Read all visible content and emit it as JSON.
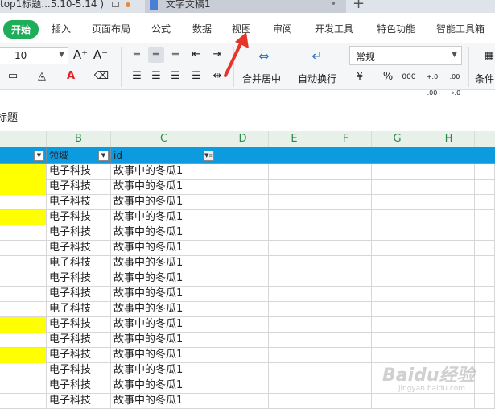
{
  "tabs": {
    "doc1_title": "top1标题...5.10-5.14 )",
    "doc2_title": "文字文稿1",
    "new_tab": "+"
  },
  "menu": {
    "home": "开始",
    "insert": "插入",
    "page_layout": "页面布局",
    "formula": "公式",
    "data": "数据",
    "view": "视图",
    "review": "审阅",
    "developer": "开发工具",
    "special": "特色功能",
    "smart_toolbox": "智能工具箱"
  },
  "ribbon": {
    "font_size": "10",
    "grow_font": "A⁺",
    "shrink_font": "A⁻",
    "merge_center": "合并居中",
    "wrap_text": "自动换行",
    "number_format": "常规",
    "currency": "¥",
    "percent": "%",
    "thousands": "000",
    "inc_decimal": "+.0 .00",
    "dec_decimal": ".00 →.0",
    "conditional": "条件"
  },
  "formula_bar": {
    "content": "标题"
  },
  "sheet": {
    "columns": [
      "B",
      "C",
      "D",
      "E",
      "F",
      "G",
      "H"
    ],
    "headers": {
      "domain": "领域",
      "id": "id"
    },
    "rows": [
      {
        "b": "电子科技",
        "c": "故事中的冬瓜1",
        "yellow": true
      },
      {
        "b": "电子科技",
        "c": "故事中的冬瓜1",
        "yellow": true
      },
      {
        "b": "电子科技",
        "c": "故事中的冬瓜1",
        "yellow": false
      },
      {
        "b": "电子科技",
        "c": "故事中的冬瓜1",
        "yellow": true
      },
      {
        "b": "电子科技",
        "c": "故事中的冬瓜1",
        "yellow": false
      },
      {
        "b": "电子科技",
        "c": "故事中的冬瓜1",
        "yellow": false
      },
      {
        "b": "电子科技",
        "c": "故事中的冬瓜1",
        "yellow": false
      },
      {
        "b": "电子科技",
        "c": "故事中的冬瓜1",
        "yellow": false
      },
      {
        "b": "电子科技",
        "c": "故事中的冬瓜1",
        "yellow": false
      },
      {
        "b": "电子科技",
        "c": "故事中的冬瓜1",
        "yellow": false
      },
      {
        "b": "电子科技",
        "c": "故事中的冬瓜1",
        "yellow": true
      },
      {
        "b": "电子科技",
        "c": "故事中的冬瓜1",
        "yellow": false
      },
      {
        "b": "电子科技",
        "c": "故事中的冬瓜1",
        "yellow": true
      },
      {
        "b": "电子科技",
        "c": "故事中的冬瓜1",
        "yellow": false
      },
      {
        "b": "电子科技",
        "c": "故事中的冬瓜1",
        "yellow": false
      },
      {
        "b": "电子科技",
        "c": "故事中的冬瓜1",
        "yellow": false
      },
      {
        "b": "电子科技",
        "c": "故事中的冬瓜1",
        "yellow": false
      }
    ]
  },
  "colors": {
    "header_row": "#0d9be0",
    "highlight": "#ffff00",
    "home_tab": "#1eae5a",
    "annotation_arrow": "#e8332a"
  },
  "watermark": {
    "text": "Baidu经验",
    "sub": "jingyan.baidu.com"
  }
}
